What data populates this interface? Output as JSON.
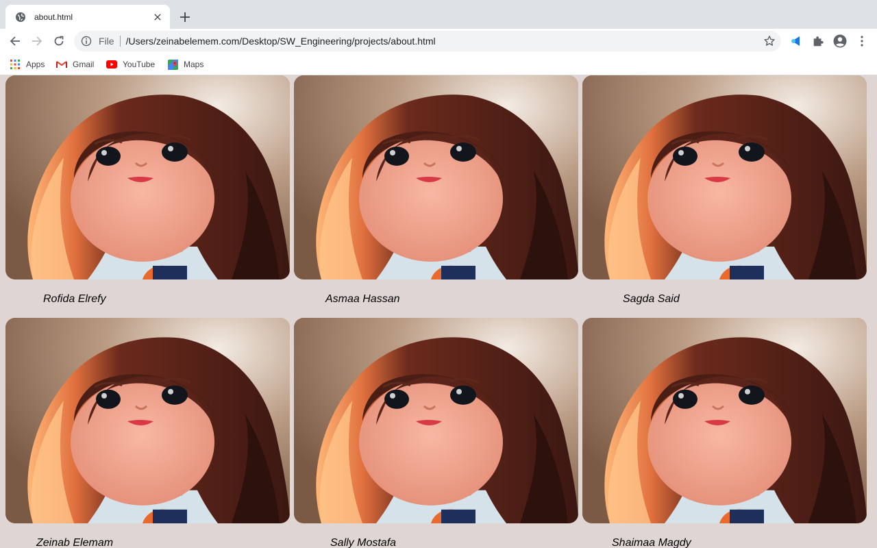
{
  "tab": {
    "title": "about.html"
  },
  "address": {
    "scheme": "File",
    "url": "/Users/zeinabelemem.com/Desktop/SW_Engineering/projects/about.html"
  },
  "bookmarks": [
    {
      "label": "Apps",
      "icon": "apps-grid-icon"
    },
    {
      "label": "Gmail",
      "icon": "gmail-icon"
    },
    {
      "label": "YouTube",
      "icon": "youtube-icon"
    },
    {
      "label": "Maps",
      "icon": "maps-icon"
    }
  ],
  "team": [
    {
      "name": "Rofida Elrefy"
    },
    {
      "name": "Asmaa Hassan"
    },
    {
      "name": "Sagda Said"
    },
    {
      "name": "Zeinab Elemam"
    },
    {
      "name": "Sally Mostafa"
    },
    {
      "name": "Shaimaa Magdy"
    }
  ],
  "colors": {
    "tabstrip": "#dee1e6",
    "page_background": "#dfd6d4",
    "extension_accent": "#1a73e8",
    "youtube_red": "#ff0000"
  }
}
